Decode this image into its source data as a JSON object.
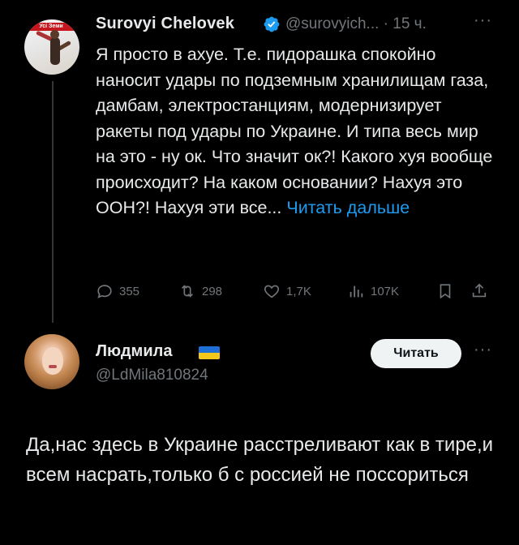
{
  "tweet1": {
    "display_name": "Surovyi Chelovek",
    "handle": "@surovyich...",
    "time": "· 15 ч.",
    "more": "···",
    "text": "Я просто в ахуе. Т.е. пидорашка спокойно наносит удары по подземным хранилищам газа, дамбам, электростанциям, модернизирует ракеты под удары по Украине. И типа весь мир на это - ну ок. Что значит ок?! Какого хуя вообще происходит? На каком основании? Нахуя это ООН?! Нахуя эти все... ",
    "read_more": "Читать дальше",
    "avatar_banner": "Усі Земи",
    "actions": {
      "replies": "355",
      "reposts": "298",
      "likes": "1,7K",
      "views": "107K"
    }
  },
  "tweet2": {
    "display_name": "Людмила",
    "handle": "@LdMila810824",
    "follow_label": "Читать",
    "more": "···",
    "text": "Да,нас здесь в Украине расстреливают как в тире,и всем насрать,только б с россией не поссориться"
  },
  "colors": {
    "background": "#000000",
    "text": "#e7e9ea",
    "secondary": "#71767b",
    "accent": "#1d9bf0",
    "flag_blue": "#1e6fd6",
    "flag_yellow": "#f2c81d"
  },
  "icons": [
    "verified-badge-icon",
    "reply-icon",
    "repost-icon",
    "like-icon",
    "views-icon",
    "bookmark-icon",
    "share-icon",
    "ukraine-flag-icon"
  ]
}
